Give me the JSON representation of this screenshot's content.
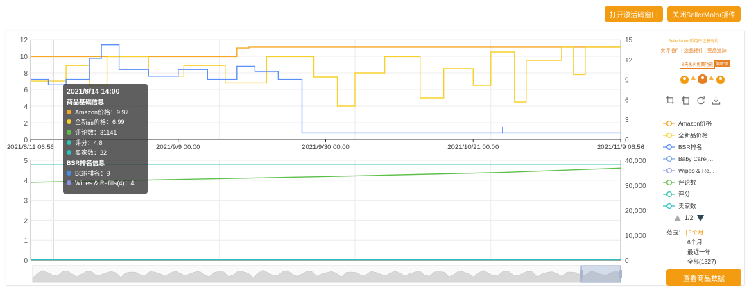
{
  "buttons": {
    "activate": "打开激活码窗口",
    "close_plugin": "关闭SellerMotor插件",
    "view_data": "查看商品数据"
  },
  "promo": {
    "line1": "SellerMotor新用户注册有礼",
    "line2": "卖评插件 | 选品插件 | 竞品追踪",
    "badge": "3天永久免费功能",
    "badge2": "限时领"
  },
  "tooltip": {
    "title": "2021/8/14 14:00",
    "section1": "商品基础信息",
    "rows1": [
      {
        "text": "Amazon价格：9.97",
        "color": "#f5a623"
      },
      {
        "text": "全新品价格：6.99",
        "color": "#f7d02c"
      },
      {
        "text": "评论数：31141",
        "color": "#5fbf4b"
      },
      {
        "text": "评分：4.8",
        "color": "#35c4b0"
      },
      {
        "text": "卖家数：22",
        "color": "#2fc0c0"
      }
    ],
    "section2": "BSR排名信息",
    "rows2": [
      {
        "text": "BSR排名：9",
        "color": "#4a90e2"
      },
      {
        "text": "Wipes & Refills(4)：4",
        "color": "#8a8fe8"
      }
    ]
  },
  "legend": [
    {
      "name": "Amazon价格",
      "color": "#f5a623"
    },
    {
      "name": "全新品价格",
      "color": "#f7d02c"
    },
    {
      "name": "BSR排名",
      "color": "#5b8ff9"
    },
    {
      "name": "Baby Care(...",
      "color": "#7aa6e8"
    },
    {
      "name": "Wipes & Re...",
      "color": "#9a9ee8"
    },
    {
      "name": "评论数",
      "color": "#5fbf4b"
    },
    {
      "name": "评分",
      "color": "#35c4b0"
    },
    {
      "name": "卖家数",
      "color": "#2fc0c0"
    }
  ],
  "pager": {
    "text": "1/2"
  },
  "range": {
    "label": "范围：",
    "selected": "3个月",
    "options": [
      "6个月",
      "最近一年",
      "全部(1327)"
    ]
  },
  "chart_data": [
    {
      "type": "line",
      "x_ticks": [
        "2021/8/11 06:56",
        "2021/9/9 00:00",
        "2021/9/30 00:00",
        "2021/10/21 00:00",
        "2021/11/9 06:56"
      ],
      "y_left_ticks": [
        "0",
        "2",
        "4",
        "6",
        "8",
        "10",
        "12"
      ],
      "y_right_ticks": [
        "0",
        "3",
        "6",
        "9",
        "12",
        "15"
      ],
      "ylim_left": [
        0,
        12
      ],
      "ylim_right": [
        0,
        15
      ],
      "series": [
        {
          "name": "Amazon价格",
          "color": "#f5a623",
          "axis": "left",
          "points": [
            [
              0,
              9.97
            ],
            [
              0.35,
              9.97
            ],
            [
              0.35,
              10.99
            ],
            [
              0.37,
              10.99
            ],
            [
              0.37,
              11.09
            ],
            [
              1,
              11.09
            ]
          ]
        },
        {
          "name": "全新品价格",
          "color": "#f7d02c",
          "axis": "left",
          "points": [
            [
              0,
              6.99
            ],
            [
              0.06,
              6.99
            ],
            [
              0.06,
              8.9
            ],
            [
              0.1,
              8.9
            ],
            [
              0.1,
              6.5
            ],
            [
              0.13,
              6.5
            ],
            [
              0.13,
              9.97
            ],
            [
              0.2,
              9.97
            ],
            [
              0.2,
              7.6
            ],
            [
              0.26,
              7.6
            ],
            [
              0.26,
              8.9
            ],
            [
              0.33,
              8.9
            ],
            [
              0.33,
              6.8
            ],
            [
              0.4,
              6.8
            ],
            [
              0.4,
              9.97
            ],
            [
              0.48,
              9.97
            ],
            [
              0.48,
              7.5
            ],
            [
              0.52,
              7.5
            ],
            [
              0.52,
              4.0
            ],
            [
              0.55,
              4.0
            ],
            [
              0.55,
              8.0
            ],
            [
              0.6,
              8.0
            ],
            [
              0.6,
              9.97
            ],
            [
              0.66,
              9.97
            ],
            [
              0.66,
              5.0
            ],
            [
              0.7,
              5.0
            ],
            [
              0.7,
              8.5
            ],
            [
              0.75,
              8.5
            ],
            [
              0.75,
              6.5
            ],
            [
              0.78,
              6.5
            ],
            [
              0.78,
              10.5
            ],
            [
              0.82,
              10.5
            ],
            [
              0.82,
              4.5
            ],
            [
              0.84,
              4.5
            ],
            [
              0.84,
              9.5
            ],
            [
              0.9,
              9.5
            ],
            [
              0.9,
              11.09
            ],
            [
              0.92,
              11.09
            ],
            [
              0.92,
              7.8
            ],
            [
              0.94,
              7.8
            ],
            [
              0.94,
              11.09
            ],
            [
              1,
              11.09
            ]
          ]
        },
        {
          "name": "BSR排名",
          "color": "#5b8ff9",
          "axis": "right",
          "points": [
            [
              0,
              9
            ],
            [
              0.03,
              9
            ],
            [
              0.03,
              8.2
            ],
            [
              0.06,
              8.2
            ],
            [
              0.06,
              9
            ],
            [
              0.1,
              9
            ],
            [
              0.1,
              12.2
            ],
            [
              0.12,
              12.2
            ],
            [
              0.12,
              14.2
            ],
            [
              0.15,
              14.2
            ],
            [
              0.15,
              10.5
            ],
            [
              0.2,
              10.5
            ],
            [
              0.2,
              9.5
            ],
            [
              0.25,
              9.5
            ],
            [
              0.25,
              10.5
            ],
            [
              0.3,
              10.5
            ],
            [
              0.3,
              9
            ],
            [
              0.35,
              9
            ],
            [
              0.35,
              11
            ],
            [
              0.38,
              11
            ],
            [
              0.38,
              10.2
            ],
            [
              0.42,
              10.2
            ],
            [
              0.42,
              9
            ],
            [
              0.46,
              9
            ],
            [
              0.46,
              1.0
            ],
            [
              0.8,
              1.0
            ],
            [
              0.8,
              1.9
            ],
            [
              0.8,
              1.0
            ],
            [
              1,
              1.0
            ]
          ]
        }
      ]
    },
    {
      "type": "line",
      "y_left_ticks": [
        "0",
        "1",
        "2",
        "3",
        "4",
        "5"
      ],
      "y_right_ticks": [
        "0",
        "10,000",
        "20,000",
        "30,000",
        "40,000"
      ],
      "ylim_left": [
        0,
        5
      ],
      "ylim_right": [
        0,
        40000
      ],
      "series": [
        {
          "name": "评分",
          "color": "#35c4b0",
          "axis": "left",
          "points": [
            [
              0,
              4.8
            ],
            [
              1,
              4.8
            ]
          ]
        },
        {
          "name": "评论数",
          "color": "#5fbf4b",
          "axis": "right",
          "points": [
            [
              0,
              31141
            ],
            [
              0.5,
              33500
            ],
            [
              0.8,
              35100
            ],
            [
              1,
              36900
            ]
          ]
        },
        {
          "name": "卖家数",
          "color": "#2fc0c0",
          "axis": "left",
          "points": [
            [
              0,
              0.02
            ],
            [
              1,
              0.02
            ]
          ]
        }
      ]
    }
  ]
}
